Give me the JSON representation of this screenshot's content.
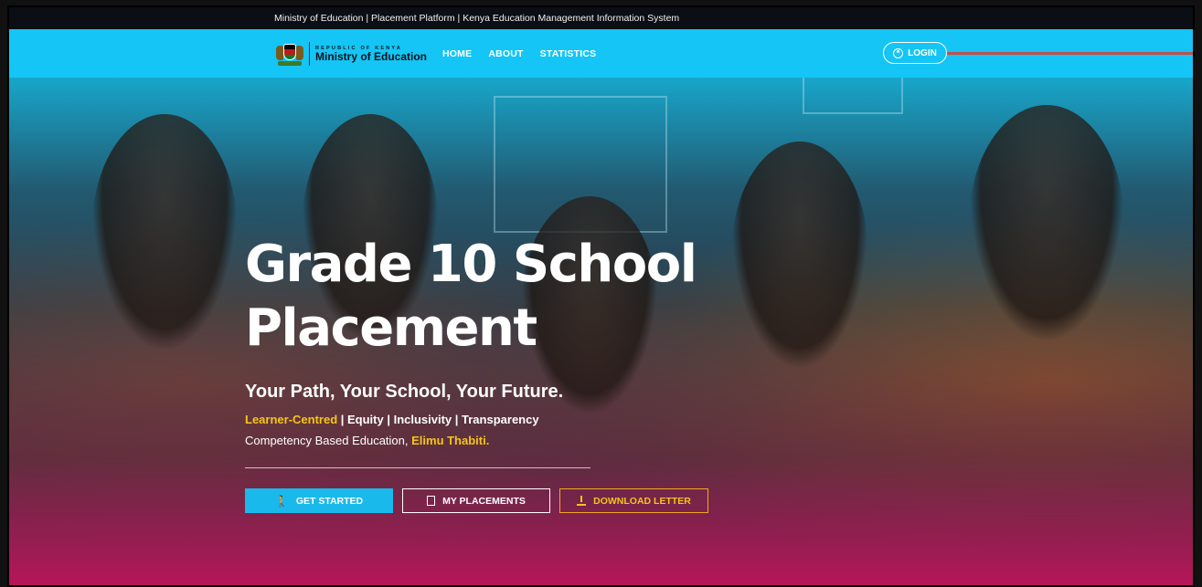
{
  "topbar": {
    "text": "Ministry of Education | Placement Platform | Kenya Education Management Information System"
  },
  "nav": {
    "logo_small": "REPUBLIC OF KENYA",
    "logo_big": "Ministry of Education",
    "links": [
      "HOME",
      "ABOUT",
      "STATISTICS"
    ],
    "login": "LOGIN"
  },
  "hero": {
    "title_line1": "Grade 10 School",
    "title_line2": "Placement",
    "tagline": "Your Path, Your School, Your Future.",
    "values": {
      "v1": "Learner-Centred",
      "rest": " | Equity | Inclusivity | Transparency"
    },
    "cbe": {
      "prefix": "Competency Based Education, ",
      "highlight": "Elimu Thabiti."
    },
    "buttons": {
      "get_started": "GET STARTED",
      "my_placements": "MY PLACEMENTS",
      "download_letter": "DOWNLOAD LETTER"
    }
  },
  "colors": {
    "accent": "#14c5f5",
    "highlight": "#f5c518",
    "bottom_gradient": "#be145a"
  }
}
